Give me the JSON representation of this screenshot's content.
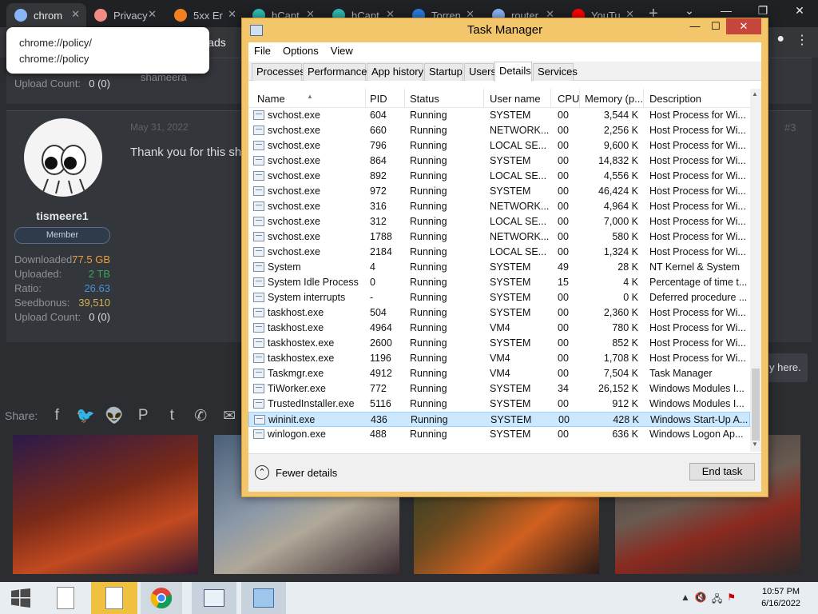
{
  "browser": {
    "tabs": [
      {
        "label": "chrom",
        "icon": "globe-icon"
      },
      {
        "label": "Privacy",
        "icon": "cloud-icon"
      },
      {
        "label": "5xx Er",
        "icon": "cloudflare-icon"
      },
      {
        "label": "hCapt",
        "icon": "hcaptcha-icon"
      },
      {
        "label": "hCapt",
        "icon": "hcaptcha-icon"
      },
      {
        "label": "Torren",
        "icon": "torrent-icon"
      },
      {
        "label": "router",
        "icon": "globe-icon"
      },
      {
        "label": "YouTu",
        "icon": "youtube-icon"
      }
    ],
    "omnibox_partial": "hreads",
    "tooltip": {
      "line1": "chrome://policy/",
      "line2": "chrome://policy"
    },
    "colors": {
      "frame": "#202124",
      "toolbar": "#35363a"
    }
  },
  "forum": {
    "upload_count_label": "Upload Count:",
    "upload_count_value": "0 (0)",
    "other_user": "shameera",
    "post": {
      "date": "May 31, 2022",
      "number": "#3",
      "message": "Thank you for this sh",
      "username": "tismeere1",
      "role": "Member",
      "stats": [
        {
          "label": "Downloaded:",
          "value": "77.5 GB",
          "color": "#e8a13a"
        },
        {
          "label": "Uploaded:",
          "value": "2 TB",
          "color": "#3aa35a"
        },
        {
          "label": "Ratio:",
          "value": "26.63",
          "color": "#4a90d9"
        },
        {
          "label": "Seedbonus:",
          "value": "39,510",
          "color": "#d4b255"
        },
        {
          "label": "Upload Count:",
          "value": "0 (0)",
          "color": "#dcddde"
        }
      ]
    },
    "here_button": "y here.",
    "share_label": "Share:",
    "share_icons": [
      "facebook-icon",
      "twitter-icon",
      "reddit-icon",
      "pinterest-icon",
      "tumblr-icon",
      "whatsapp-icon",
      "email-icon"
    ]
  },
  "taskmanager": {
    "title": "Task Manager",
    "menu": [
      "File",
      "Options",
      "View"
    ],
    "tabs": [
      "Processes",
      "Performance",
      "App history",
      "Startup",
      "Users",
      "Details",
      "Services"
    ],
    "selected_tab": "Details",
    "columns": [
      "Name",
      "PID",
      "Status",
      "User name",
      "CPU",
      "Memory (p...",
      "Description"
    ],
    "rows": [
      {
        "name": "svchost.exe",
        "pid": "604",
        "status": "Running",
        "user": "SYSTEM",
        "cpu": "00",
        "mem": "3,544 K",
        "desc": "Host Process for Wi..."
      },
      {
        "name": "svchost.exe",
        "pid": "660",
        "status": "Running",
        "user": "NETWORK...",
        "cpu": "00",
        "mem": "2,256 K",
        "desc": "Host Process for Wi..."
      },
      {
        "name": "svchost.exe",
        "pid": "796",
        "status": "Running",
        "user": "LOCAL SE...",
        "cpu": "00",
        "mem": "9,600 K",
        "desc": "Host Process for Wi..."
      },
      {
        "name": "svchost.exe",
        "pid": "864",
        "status": "Running",
        "user": "SYSTEM",
        "cpu": "00",
        "mem": "14,832 K",
        "desc": "Host Process for Wi..."
      },
      {
        "name": "svchost.exe",
        "pid": "892",
        "status": "Running",
        "user": "LOCAL SE...",
        "cpu": "00",
        "mem": "4,556 K",
        "desc": "Host Process for Wi..."
      },
      {
        "name": "svchost.exe",
        "pid": "972",
        "status": "Running",
        "user": "SYSTEM",
        "cpu": "00",
        "mem": "46,424 K",
        "desc": "Host Process for Wi..."
      },
      {
        "name": "svchost.exe",
        "pid": "316",
        "status": "Running",
        "user": "NETWORK...",
        "cpu": "00",
        "mem": "4,964 K",
        "desc": "Host Process for Wi..."
      },
      {
        "name": "svchost.exe",
        "pid": "312",
        "status": "Running",
        "user": "LOCAL SE...",
        "cpu": "00",
        "mem": "7,000 K",
        "desc": "Host Process for Wi..."
      },
      {
        "name": "svchost.exe",
        "pid": "1788",
        "status": "Running",
        "user": "NETWORK...",
        "cpu": "00",
        "mem": "580 K",
        "desc": "Host Process for Wi..."
      },
      {
        "name": "svchost.exe",
        "pid": "2184",
        "status": "Running",
        "user": "LOCAL SE...",
        "cpu": "00",
        "mem": "1,324 K",
        "desc": "Host Process for Wi..."
      },
      {
        "name": "System",
        "pid": "4",
        "status": "Running",
        "user": "SYSTEM",
        "cpu": "49",
        "mem": "28 K",
        "desc": "NT Kernel & System"
      },
      {
        "name": "System Idle Process",
        "pid": "0",
        "status": "Running",
        "user": "SYSTEM",
        "cpu": "15",
        "mem": "4 K",
        "desc": "Percentage of time t..."
      },
      {
        "name": "System interrupts",
        "pid": "-",
        "status": "Running",
        "user": "SYSTEM",
        "cpu": "00",
        "mem": "0 K",
        "desc": "Deferred procedure ..."
      },
      {
        "name": "taskhost.exe",
        "pid": "504",
        "status": "Running",
        "user": "SYSTEM",
        "cpu": "00",
        "mem": "2,360 K",
        "desc": "Host Process for Wi..."
      },
      {
        "name": "taskhost.exe",
        "pid": "4964",
        "status": "Running",
        "user": "VM4",
        "cpu": "00",
        "mem": "780 K",
        "desc": "Host Process for Wi..."
      },
      {
        "name": "taskhostex.exe",
        "pid": "2600",
        "status": "Running",
        "user": "SYSTEM",
        "cpu": "00",
        "mem": "852 K",
        "desc": "Host Process for Wi..."
      },
      {
        "name": "taskhostex.exe",
        "pid": "1196",
        "status": "Running",
        "user": "VM4",
        "cpu": "00",
        "mem": "1,708 K",
        "desc": "Host Process for Wi..."
      },
      {
        "name": "Taskmgr.exe",
        "pid": "4912",
        "status": "Running",
        "user": "VM4",
        "cpu": "00",
        "mem": "7,504 K",
        "desc": "Task Manager"
      },
      {
        "name": "TiWorker.exe",
        "pid": "772",
        "status": "Running",
        "user": "SYSTEM",
        "cpu": "34",
        "mem": "26,152 K",
        "desc": "Windows Modules I..."
      },
      {
        "name": "TrustedInstaller.exe",
        "pid": "5116",
        "status": "Running",
        "user": "SYSTEM",
        "cpu": "00",
        "mem": "912 K",
        "desc": "Windows Modules I..."
      },
      {
        "name": "wininit.exe",
        "pid": "436",
        "status": "Running",
        "user": "SYSTEM",
        "cpu": "00",
        "mem": "428 K",
        "desc": "Windows Start-Up A...",
        "selected": true
      },
      {
        "name": "winlogon.exe",
        "pid": "488",
        "status": "Running",
        "user": "SYSTEM",
        "cpu": "00",
        "mem": "636 K",
        "desc": "Windows Logon Ap..."
      }
    ],
    "fewer_details": "Fewer details",
    "end_task": "End task",
    "colors": {
      "frame": "#f4c66c",
      "close": "#c7463c",
      "selection": "#cce8ff"
    }
  },
  "taskbar": {
    "time": "10:57 PM",
    "date": "6/16/2022",
    "colors": {
      "background": "#e8edf2"
    }
  }
}
